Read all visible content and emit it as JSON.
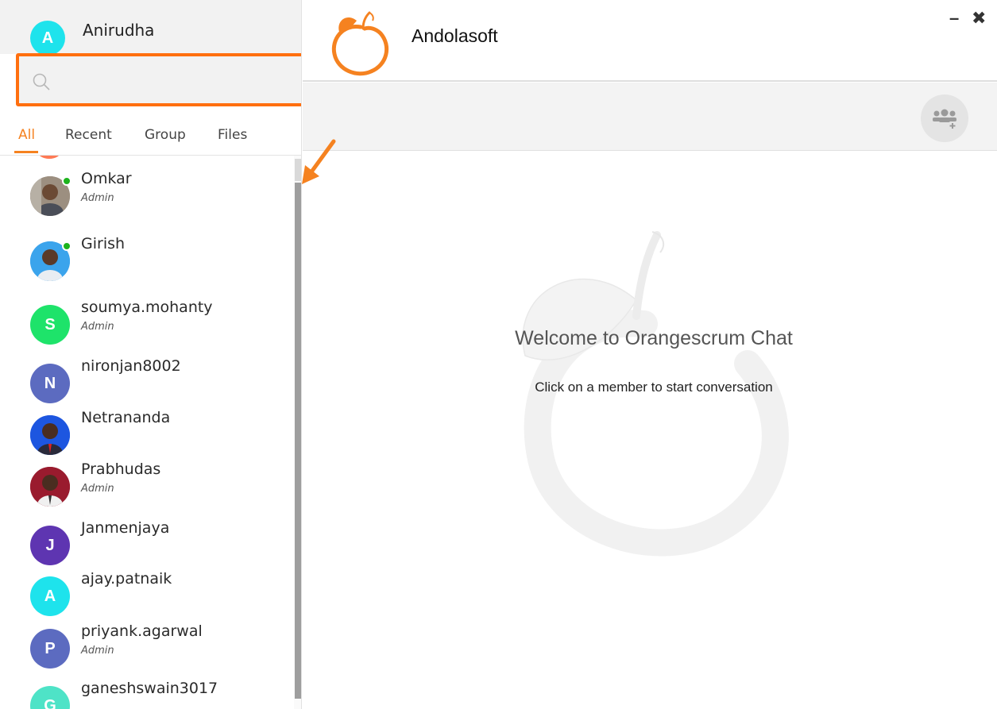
{
  "current_user": {
    "name": "Anirudha",
    "initial": "A",
    "avatar_color": "#1ee3ec"
  },
  "search": {
    "placeholder": ""
  },
  "tabs": [
    {
      "label": "All",
      "active": true
    },
    {
      "label": "Recent",
      "active": false
    },
    {
      "label": "Group",
      "active": false
    },
    {
      "label": "Files",
      "active": false
    }
  ],
  "contacts": [
    {
      "name": "Omkar",
      "role": "Admin",
      "online": true,
      "avatar": "photo"
    },
    {
      "name": "Girish",
      "role": "",
      "online": true,
      "avatar": "photo"
    },
    {
      "name": "soumya.mohanty",
      "role": "Admin",
      "initial": "S",
      "avatar_color": "#1ee36a"
    },
    {
      "name": "nironjan8002",
      "role": "",
      "initial": "N",
      "avatar_color": "#5c6bc0"
    },
    {
      "name": "Netrananda",
      "role": "",
      "avatar": "photo"
    },
    {
      "name": "Prabhudas",
      "role": "Admin",
      "avatar": "photo"
    },
    {
      "name": "Janmenjaya",
      "role": "",
      "initial": "J",
      "avatar_color": "#5e35b1"
    },
    {
      "name": "ajay.patnaik",
      "role": "",
      "initial": "A",
      "avatar_color": "#1ee3ec"
    },
    {
      "name": "priyank.agarwal",
      "role": "Admin",
      "initial": "P",
      "avatar_color": "#5c6bc0"
    },
    {
      "name": "ganeshswain3017",
      "role": "",
      "initial": "G",
      "avatar_color": "#4ee3c7"
    }
  ],
  "header": {
    "title": "Andolasoft",
    "minimize_icon": "minimize-icon",
    "close_icon": "close-icon"
  },
  "toolbar": {
    "add_group_icon": "add-group-icon"
  },
  "welcome": {
    "title": "Welcome to Orangescrum Chat",
    "hint": "Click on a member to start conversation"
  },
  "colors": {
    "accent": "#f58220",
    "highlight_box": "#ff6f0f",
    "online": "#1db31d"
  }
}
